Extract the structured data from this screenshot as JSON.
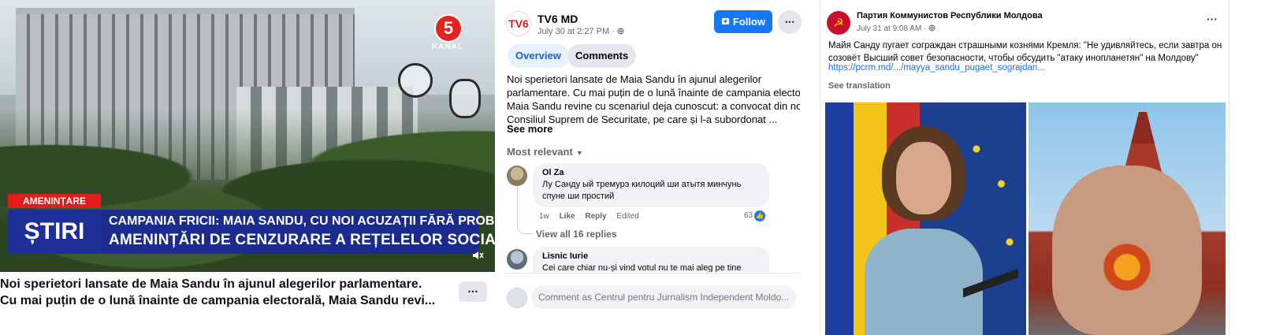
{
  "video": {
    "channel_logo": "5",
    "channel_name": "KANAL",
    "threat_tag": "AMENINȚARE",
    "news_label": "ȘTIRI",
    "headline_line1": "CAMPANIA FRICII: MAIA SANDU, CU NOI ACUZAȚII FĂRĂ PROBE ȘI",
    "headline_line2": "AMENINȚĂRI DE CENZURARE A REȚELELOR SOCIALE"
  },
  "left_post": {
    "text_line1": "Noi sperietori lansate de Maia Sandu în ajunul alegerilor parlamentare.",
    "text_line2": "Cu mai puțin de o lună înainte de campania electorală, Maia Sandu revi...",
    "more_label": "..."
  },
  "mid_post": {
    "logo": "TV6",
    "page_name": "TV6 MD",
    "date": "July 30 at 2:27 PM · ",
    "follow_label": "Follow",
    "more_label": "...",
    "tabs": [
      "Overview",
      "Comments"
    ],
    "text_lines": [
      "Noi sperietori lansate de Maia Sandu în ajunul alegerilor",
      "parlamentare. Cu mai puțin de o lună înainte de campania electorală",
      "Maia Sandu revine cu scenariul deja cunoscut: a convocat din nou",
      "Consiliul Suprem de Securitate, pe care și l-a subordonat ..."
    ],
    "see_more": "See more",
    "sort_label": "Most relevant",
    "comments": [
      {
        "name": "Ol Za",
        "text_line1": "Лу Санду ый тремурэ килоций ши атытя минчунь",
        "text_line2": "спуне ши простий",
        "time": "1w",
        "like": "Like",
        "reply": "Reply",
        "edited": "Edited",
        "likes": "63"
      },
      {
        "name": "Lisnic Iurie",
        "text_line1": "Cei care chiar nu-și vind votul nu te mai aleg pe tine"
      }
    ],
    "view_replies": "View all 16 replies",
    "comment_placeholder": "Comment as Centrul pentru Jurnalism Independent Moldo..."
  },
  "right_post": {
    "page_name": "Партия Коммунистов Республики Молдова",
    "date": "July 31 at 9:08 AM · ",
    "more_label": "···",
    "text_line1": "Майя Санду пугает сограждан страшными кознями Кремля: \"Не удивляйтесь, если завтра она",
    "text_line2": "созовёт Высший совет безопасности, чтобы обсудить \"атаку инопланетян\" на Молдову\"",
    "link": "https://pcrm.md/.../mayya_sandu_pugaet_sograjdan...",
    "translate": "See translation"
  },
  "icons": {
    "volume": "speaker-icon",
    "globe": "globe-icon",
    "follow": "follow-plus-icon",
    "sort": "chevron-down-icon",
    "like": "thumbs-up-icon"
  },
  "colors": {
    "facebook_blue": "#1877f2",
    "news_red": "#e31b1b",
    "news_blue": "#1e2f9a"
  }
}
